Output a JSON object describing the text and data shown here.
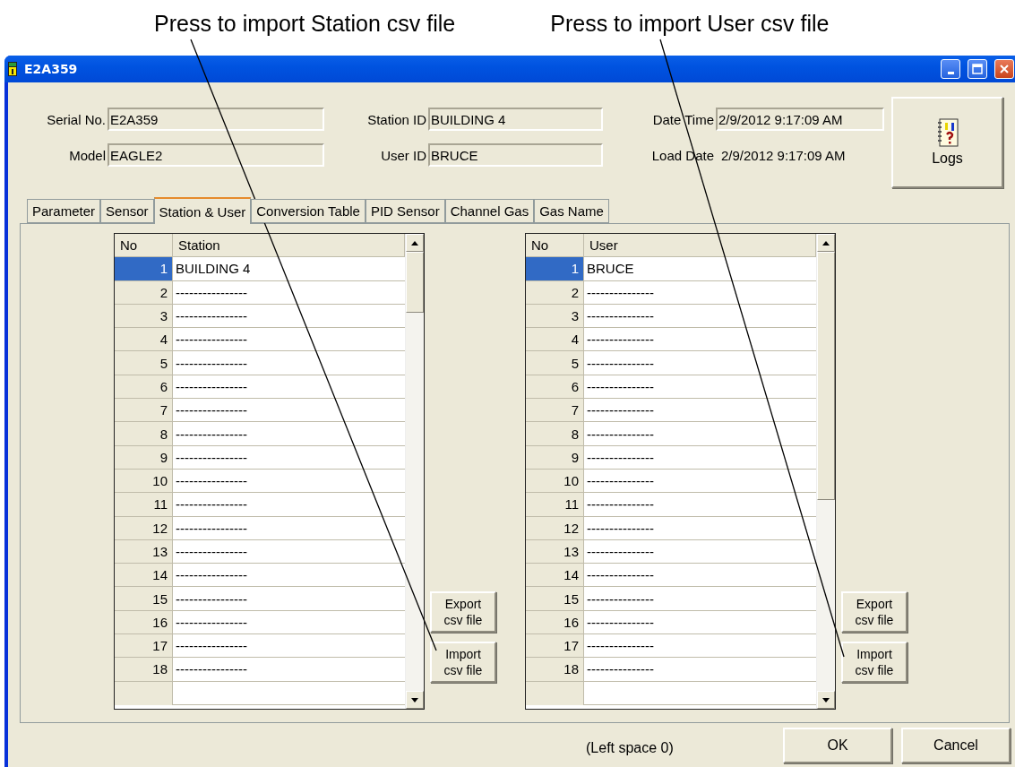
{
  "annotations": [
    {
      "text": "Press to import Station csv file"
    },
    {
      "text": "Press to import User csv file"
    }
  ],
  "window": {
    "title": "E2A359"
  },
  "header": {
    "fields": [
      {
        "label": "Serial No.",
        "value": "E2A359",
        "kind": "field"
      },
      {
        "label": "Station ID",
        "value": "BUILDING 4",
        "kind": "field"
      },
      {
        "label": "Date Time",
        "value": "2/9/2012 9:17:09 AM",
        "kind": "field"
      },
      {
        "label": "Model",
        "value": "EAGLE2",
        "kind": "field"
      },
      {
        "label": "User ID",
        "value": "BRUCE",
        "kind": "field"
      },
      {
        "label": "Load Date",
        "value": "2/9/2012 9:17:09 AM",
        "kind": "plain"
      }
    ],
    "logs_button": {
      "label": "Logs"
    }
  },
  "tabs": [
    {
      "label": "Parameter",
      "selected": false
    },
    {
      "label": "Sensor",
      "selected": false
    },
    {
      "label": "Station & User",
      "selected": true
    },
    {
      "label": "Conversion Table",
      "selected": false
    },
    {
      "label": "PID Sensor",
      "selected": false
    },
    {
      "label": "Channel Gas",
      "selected": false
    },
    {
      "label": "Gas Name",
      "selected": false
    }
  ],
  "lists": [
    {
      "columns": [
        "No",
        "Station"
      ],
      "rows": [
        {
          "no": "1",
          "name": "BUILDING 4",
          "selected": true
        },
        {
          "no": "2",
          "name": "----------------",
          "selected": false
        },
        {
          "no": "3",
          "name": "----------------",
          "selected": false
        },
        {
          "no": "4",
          "name": "----------------",
          "selected": false
        },
        {
          "no": "5",
          "name": "----------------",
          "selected": false
        },
        {
          "no": "6",
          "name": "----------------",
          "selected": false
        },
        {
          "no": "7",
          "name": "----------------",
          "selected": false
        },
        {
          "no": "8",
          "name": "----------------",
          "selected": false
        },
        {
          "no": "9",
          "name": "----------------",
          "selected": false
        },
        {
          "no": "10",
          "name": "----------------",
          "selected": false
        },
        {
          "no": "11",
          "name": "----------------",
          "selected": false
        },
        {
          "no": "12",
          "name": "----------------",
          "selected": false
        },
        {
          "no": "13",
          "name": "----------------",
          "selected": false
        },
        {
          "no": "14",
          "name": "----------------",
          "selected": false
        },
        {
          "no": "15",
          "name": "----------------",
          "selected": false
        },
        {
          "no": "16",
          "name": "----------------",
          "selected": false
        },
        {
          "no": "17",
          "name": "----------------",
          "selected": false
        },
        {
          "no": "18",
          "name": "----------------",
          "selected": false
        }
      ],
      "buttons": [
        "Export csv file",
        "Import csv file"
      ]
    },
    {
      "columns": [
        "No",
        "User"
      ],
      "rows": [
        {
          "no": "1",
          "name": "BRUCE",
          "selected": true
        },
        {
          "no": "2",
          "name": "---------------",
          "selected": false
        },
        {
          "no": "3",
          "name": "---------------",
          "selected": false
        },
        {
          "no": "4",
          "name": "---------------",
          "selected": false
        },
        {
          "no": "5",
          "name": "---------------",
          "selected": false
        },
        {
          "no": "6",
          "name": "---------------",
          "selected": false
        },
        {
          "no": "7",
          "name": "---------------",
          "selected": false
        },
        {
          "no": "8",
          "name": "---------------",
          "selected": false
        },
        {
          "no": "9",
          "name": "---------------",
          "selected": false
        },
        {
          "no": "10",
          "name": "---------------",
          "selected": false
        },
        {
          "no": "11",
          "name": "---------------",
          "selected": false
        },
        {
          "no": "12",
          "name": "---------------",
          "selected": false
        },
        {
          "no": "13",
          "name": "---------------",
          "selected": false
        },
        {
          "no": "14",
          "name": "---------------",
          "selected": false
        },
        {
          "no": "15",
          "name": "---------------",
          "selected": false
        },
        {
          "no": "16",
          "name": "---------------",
          "selected": false
        },
        {
          "no": "17",
          "name": "---------------",
          "selected": false
        },
        {
          "no": "18",
          "name": "---------------",
          "selected": false
        }
      ],
      "buttons": [
        "Export csv file",
        "Import csv file"
      ]
    }
  ],
  "status": "(Left space 0)",
  "buttons": [
    "OK",
    "Cancel"
  ]
}
